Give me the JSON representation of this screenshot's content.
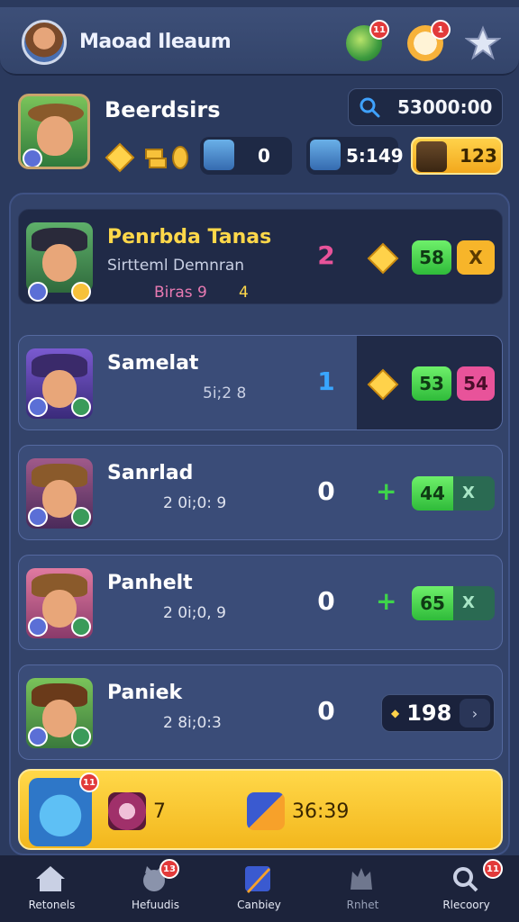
{
  "topbar": {
    "title": "Maoad Ileaum",
    "icons": [
      {
        "name": "globe-icon",
        "badge": "11"
      },
      {
        "name": "cat-icon",
        "badge": "1"
      },
      {
        "name": "star-icon",
        "badge": ""
      }
    ]
  },
  "profile": {
    "name": "Beerdsirs",
    "search_value": "53000:00",
    "resources": {
      "chip1_value": "0",
      "chip2_value": "5:149",
      "chip3_value": "123"
    }
  },
  "rows": [
    {
      "name": "Penrbda Tanas",
      "sub1": "Sirtteml Demnran",
      "sub2": "Biras 9",
      "sub3": "4",
      "rank": "2",
      "pill": "58",
      "pill2": "X"
    },
    {
      "name": "Samelat",
      "sub1": "5i;2 8",
      "rank": "1",
      "pill": "53",
      "pill2": "54"
    },
    {
      "name": "Sanrlad",
      "sub1": "2 0i;0: 9",
      "rank": "0",
      "pill": "44",
      "pill2": "X"
    },
    {
      "name": "Panhelt",
      "sub1": "2 0i;0, 9",
      "rank": "0",
      "pill": "65",
      "pill2": "X"
    },
    {
      "name": "Paniek",
      "sub1": "2 8i;0:3",
      "rank": "0",
      "score": "198"
    }
  ],
  "ready": {
    "badge": "11",
    "item1": "7",
    "item2": "36:39"
  },
  "nav": [
    {
      "label": "Retonels",
      "badge": ""
    },
    {
      "label": "Hefuudis",
      "badge": "13"
    },
    {
      "label": "Canbiey",
      "badge": ""
    },
    {
      "label": "Rnhet",
      "badge": ""
    },
    {
      "label": "Rlecoory",
      "badge": "11"
    }
  ],
  "colors": {
    "accent_gold": "#f3b71d",
    "green": "#3ed44a",
    "pink": "#e8539a",
    "blue_rank": "#39a6ff"
  }
}
